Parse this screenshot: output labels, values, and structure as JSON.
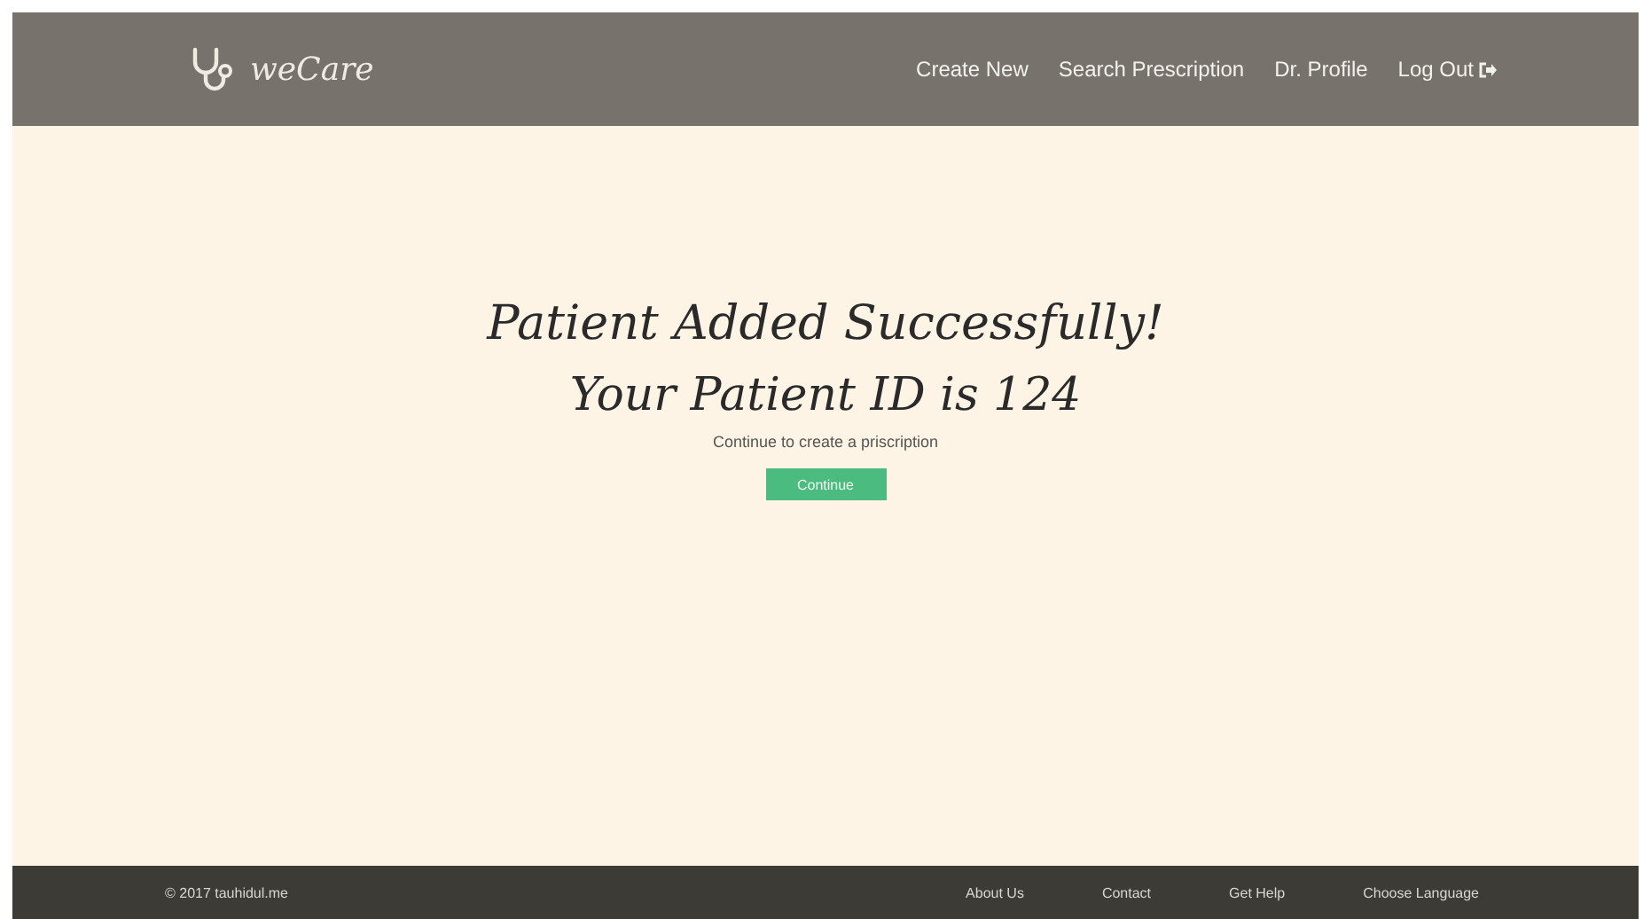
{
  "header": {
    "brand": "weCare",
    "nav": [
      {
        "label": "Create New",
        "kind": "link"
      },
      {
        "label": "Search Prescription",
        "kind": "link"
      },
      {
        "label": "Dr. Profile",
        "kind": "link"
      },
      {
        "label": "Log Out",
        "kind": "logout"
      }
    ]
  },
  "message": {
    "title": "Patient Added Successfully!",
    "subtitle": "Your Patient ID is 124",
    "hint": "Continue to create a priscription",
    "button": "Continue"
  },
  "footer": {
    "copyright": "© 2017 tauhidul.me",
    "links": [
      "About Us",
      "Contact",
      "Get Help",
      "Choose Language"
    ]
  }
}
